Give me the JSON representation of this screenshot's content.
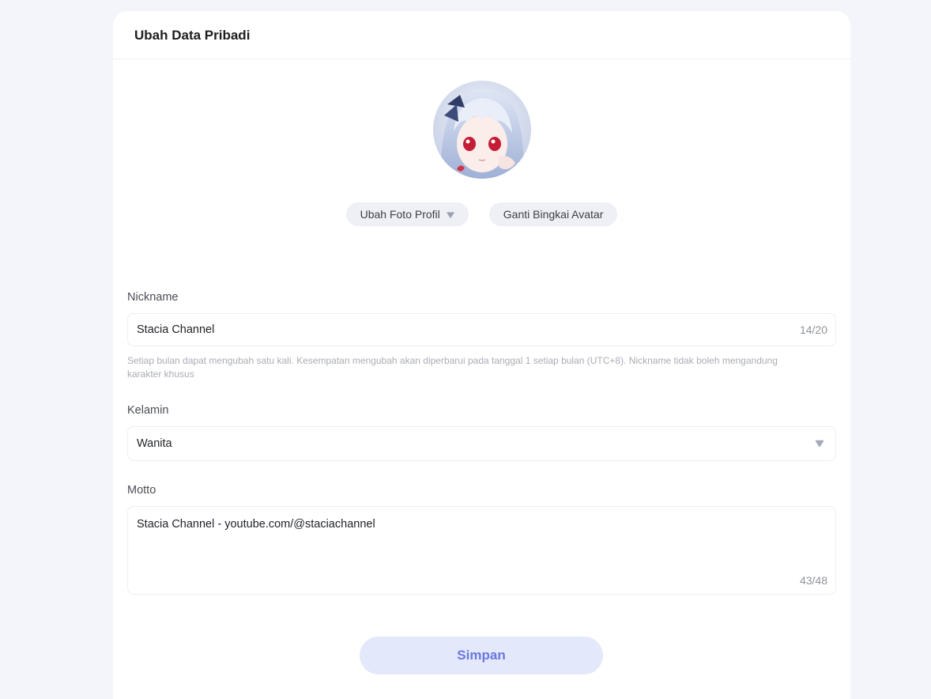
{
  "header": {
    "title": "Ubah Data Pribadi"
  },
  "avatar": {
    "icon": "avatar-image"
  },
  "actions": {
    "change_photo_label": "Ubah Foto Profil",
    "change_frame_label": "Ganti Bingkai Avatar"
  },
  "nickname": {
    "label": "Nickname",
    "value": "Stacia Channel",
    "counter": "14/20",
    "hint": "Setiap bulan dapat mengubah satu kali. Kesempatan mengubah akan diperbarui pada tanggal 1 setiap bulan (UTC+8). Nickname tidak boleh mengandung karakter khusus"
  },
  "gender": {
    "label": "Kelamin",
    "value": "Wanita"
  },
  "motto": {
    "label": "Motto",
    "value": "Stacia Channel - youtube.com/@staciachannel",
    "counter": "43/48"
  },
  "save_label": "Simpan",
  "colors": {
    "accent": "#6a78db",
    "button_bg": "#e4e8fb",
    "page_bg": "#f4f5fa"
  }
}
